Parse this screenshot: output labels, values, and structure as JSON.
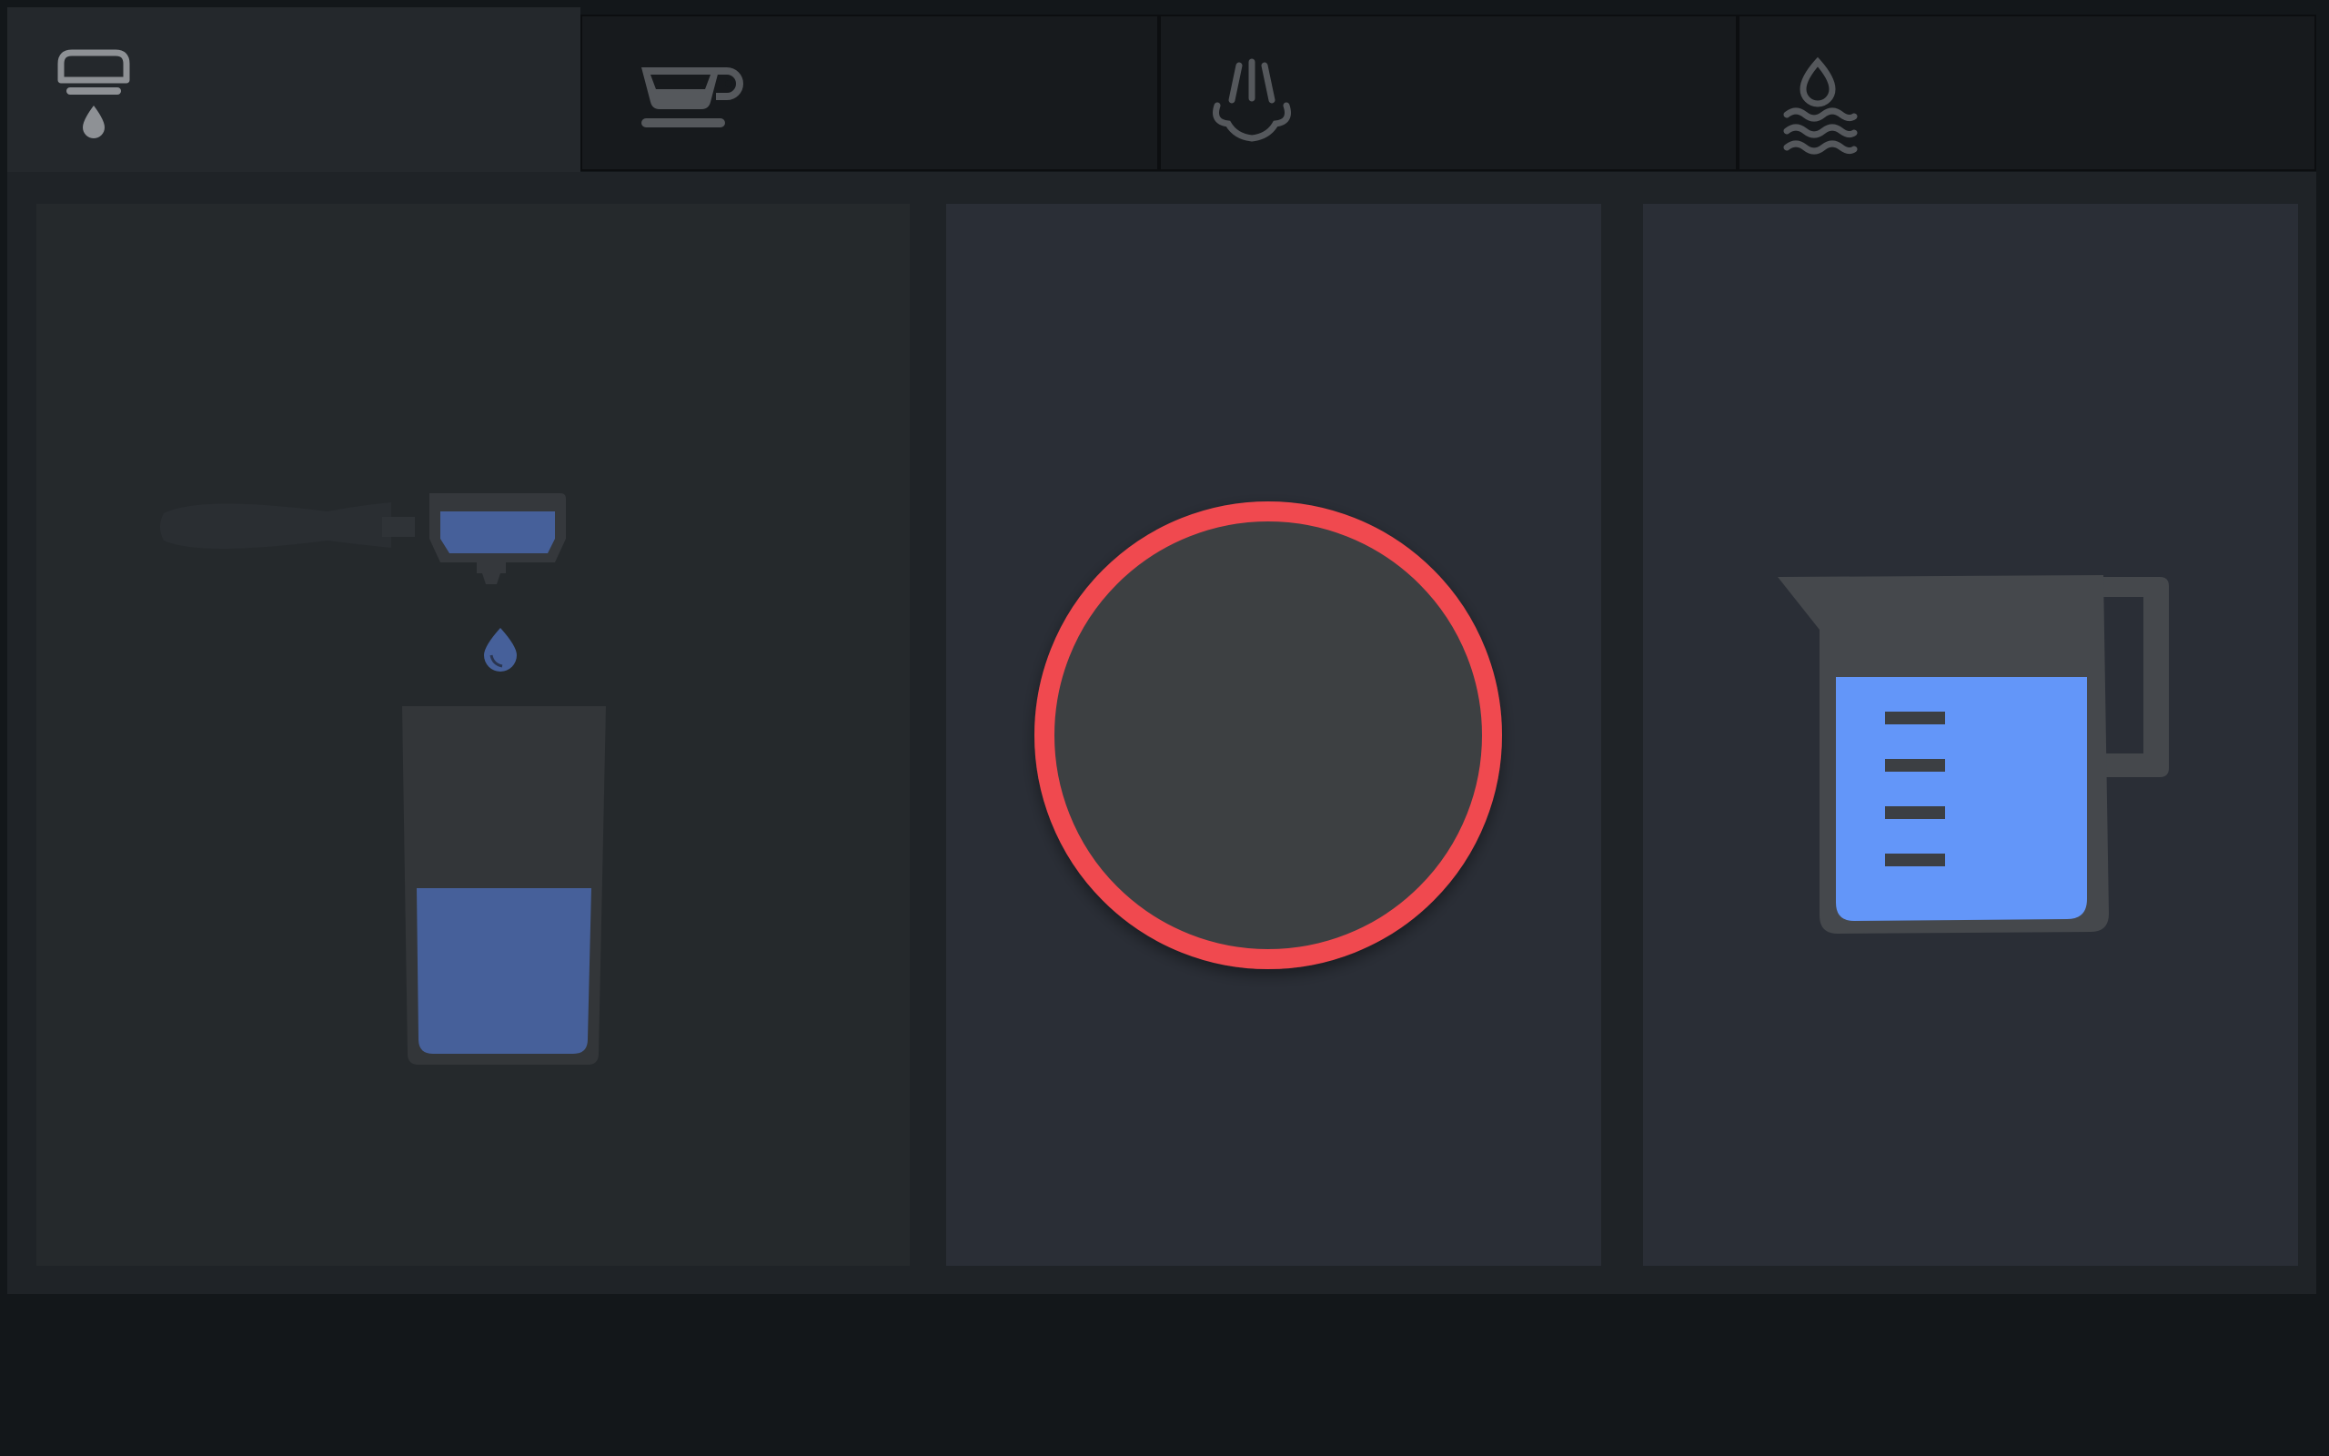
{
  "tabs": [
    {
      "icon": "portafilter-drip-icon",
      "active": true
    },
    {
      "icon": "coffee-cup-icon",
      "active": false
    },
    {
      "icon": "steam-wand-icon",
      "active": false
    },
    {
      "icon": "hot-water-icon",
      "active": false
    }
  ],
  "cards": [
    {
      "icon": "espresso-shot-icon",
      "fill_level": 0.5
    },
    {
      "icon": "stop-button-icon"
    },
    {
      "icon": "measuring-jug-icon",
      "fill_level": 0.75
    }
  ],
  "colors": {
    "background": "#13171a",
    "panel": "#1f2327",
    "tab_active": "#24282c",
    "tab_inactive": "#171a1d",
    "icon_gray": "#8e9195",
    "icon_dim": "#55585c",
    "water_dim": "#46609a",
    "water_bright": "#6396f9",
    "stop_ring": "#f04a4f",
    "stop_fill": "#3c3f43"
  }
}
